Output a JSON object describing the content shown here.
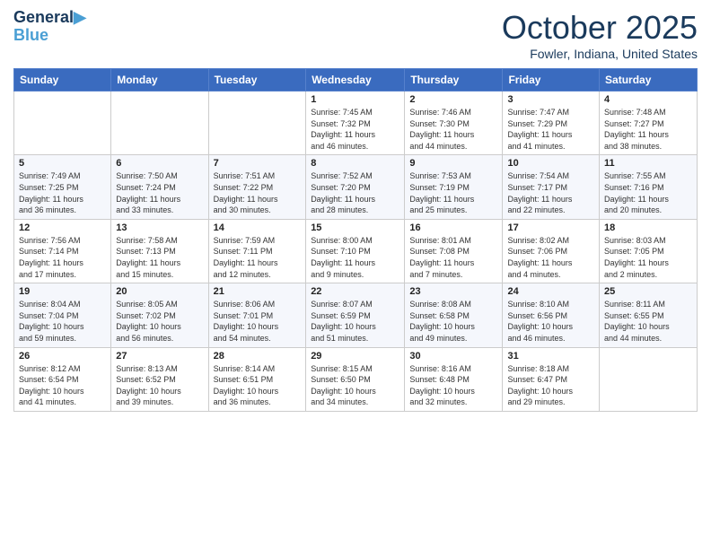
{
  "header": {
    "logo_line1": "General",
    "logo_line2": "Blue",
    "month": "October 2025",
    "location": "Fowler, Indiana, United States"
  },
  "days_of_week": [
    "Sunday",
    "Monday",
    "Tuesday",
    "Wednesday",
    "Thursday",
    "Friday",
    "Saturday"
  ],
  "weeks": [
    [
      {
        "day": "",
        "info": ""
      },
      {
        "day": "",
        "info": ""
      },
      {
        "day": "",
        "info": ""
      },
      {
        "day": "1",
        "info": "Sunrise: 7:45 AM\nSunset: 7:32 PM\nDaylight: 11 hours\nand 46 minutes."
      },
      {
        "day": "2",
        "info": "Sunrise: 7:46 AM\nSunset: 7:30 PM\nDaylight: 11 hours\nand 44 minutes."
      },
      {
        "day": "3",
        "info": "Sunrise: 7:47 AM\nSunset: 7:29 PM\nDaylight: 11 hours\nand 41 minutes."
      },
      {
        "day": "4",
        "info": "Sunrise: 7:48 AM\nSunset: 7:27 PM\nDaylight: 11 hours\nand 38 minutes."
      }
    ],
    [
      {
        "day": "5",
        "info": "Sunrise: 7:49 AM\nSunset: 7:25 PM\nDaylight: 11 hours\nand 36 minutes."
      },
      {
        "day": "6",
        "info": "Sunrise: 7:50 AM\nSunset: 7:24 PM\nDaylight: 11 hours\nand 33 minutes."
      },
      {
        "day": "7",
        "info": "Sunrise: 7:51 AM\nSunset: 7:22 PM\nDaylight: 11 hours\nand 30 minutes."
      },
      {
        "day": "8",
        "info": "Sunrise: 7:52 AM\nSunset: 7:20 PM\nDaylight: 11 hours\nand 28 minutes."
      },
      {
        "day": "9",
        "info": "Sunrise: 7:53 AM\nSunset: 7:19 PM\nDaylight: 11 hours\nand 25 minutes."
      },
      {
        "day": "10",
        "info": "Sunrise: 7:54 AM\nSunset: 7:17 PM\nDaylight: 11 hours\nand 22 minutes."
      },
      {
        "day": "11",
        "info": "Sunrise: 7:55 AM\nSunset: 7:16 PM\nDaylight: 11 hours\nand 20 minutes."
      }
    ],
    [
      {
        "day": "12",
        "info": "Sunrise: 7:56 AM\nSunset: 7:14 PM\nDaylight: 11 hours\nand 17 minutes."
      },
      {
        "day": "13",
        "info": "Sunrise: 7:58 AM\nSunset: 7:13 PM\nDaylight: 11 hours\nand 15 minutes."
      },
      {
        "day": "14",
        "info": "Sunrise: 7:59 AM\nSunset: 7:11 PM\nDaylight: 11 hours\nand 12 minutes."
      },
      {
        "day": "15",
        "info": "Sunrise: 8:00 AM\nSunset: 7:10 PM\nDaylight: 11 hours\nand 9 minutes."
      },
      {
        "day": "16",
        "info": "Sunrise: 8:01 AM\nSunset: 7:08 PM\nDaylight: 11 hours\nand 7 minutes."
      },
      {
        "day": "17",
        "info": "Sunrise: 8:02 AM\nSunset: 7:06 PM\nDaylight: 11 hours\nand 4 minutes."
      },
      {
        "day": "18",
        "info": "Sunrise: 8:03 AM\nSunset: 7:05 PM\nDaylight: 11 hours\nand 2 minutes."
      }
    ],
    [
      {
        "day": "19",
        "info": "Sunrise: 8:04 AM\nSunset: 7:04 PM\nDaylight: 10 hours\nand 59 minutes."
      },
      {
        "day": "20",
        "info": "Sunrise: 8:05 AM\nSunset: 7:02 PM\nDaylight: 10 hours\nand 56 minutes."
      },
      {
        "day": "21",
        "info": "Sunrise: 8:06 AM\nSunset: 7:01 PM\nDaylight: 10 hours\nand 54 minutes."
      },
      {
        "day": "22",
        "info": "Sunrise: 8:07 AM\nSunset: 6:59 PM\nDaylight: 10 hours\nand 51 minutes."
      },
      {
        "day": "23",
        "info": "Sunrise: 8:08 AM\nSunset: 6:58 PM\nDaylight: 10 hours\nand 49 minutes."
      },
      {
        "day": "24",
        "info": "Sunrise: 8:10 AM\nSunset: 6:56 PM\nDaylight: 10 hours\nand 46 minutes."
      },
      {
        "day": "25",
        "info": "Sunrise: 8:11 AM\nSunset: 6:55 PM\nDaylight: 10 hours\nand 44 minutes."
      }
    ],
    [
      {
        "day": "26",
        "info": "Sunrise: 8:12 AM\nSunset: 6:54 PM\nDaylight: 10 hours\nand 41 minutes."
      },
      {
        "day": "27",
        "info": "Sunrise: 8:13 AM\nSunset: 6:52 PM\nDaylight: 10 hours\nand 39 minutes."
      },
      {
        "day": "28",
        "info": "Sunrise: 8:14 AM\nSunset: 6:51 PM\nDaylight: 10 hours\nand 36 minutes."
      },
      {
        "day": "29",
        "info": "Sunrise: 8:15 AM\nSunset: 6:50 PM\nDaylight: 10 hours\nand 34 minutes."
      },
      {
        "day": "30",
        "info": "Sunrise: 8:16 AM\nSunset: 6:48 PM\nDaylight: 10 hours\nand 32 minutes."
      },
      {
        "day": "31",
        "info": "Sunrise: 8:18 AM\nSunset: 6:47 PM\nDaylight: 10 hours\nand 29 minutes."
      },
      {
        "day": "",
        "info": ""
      }
    ]
  ]
}
